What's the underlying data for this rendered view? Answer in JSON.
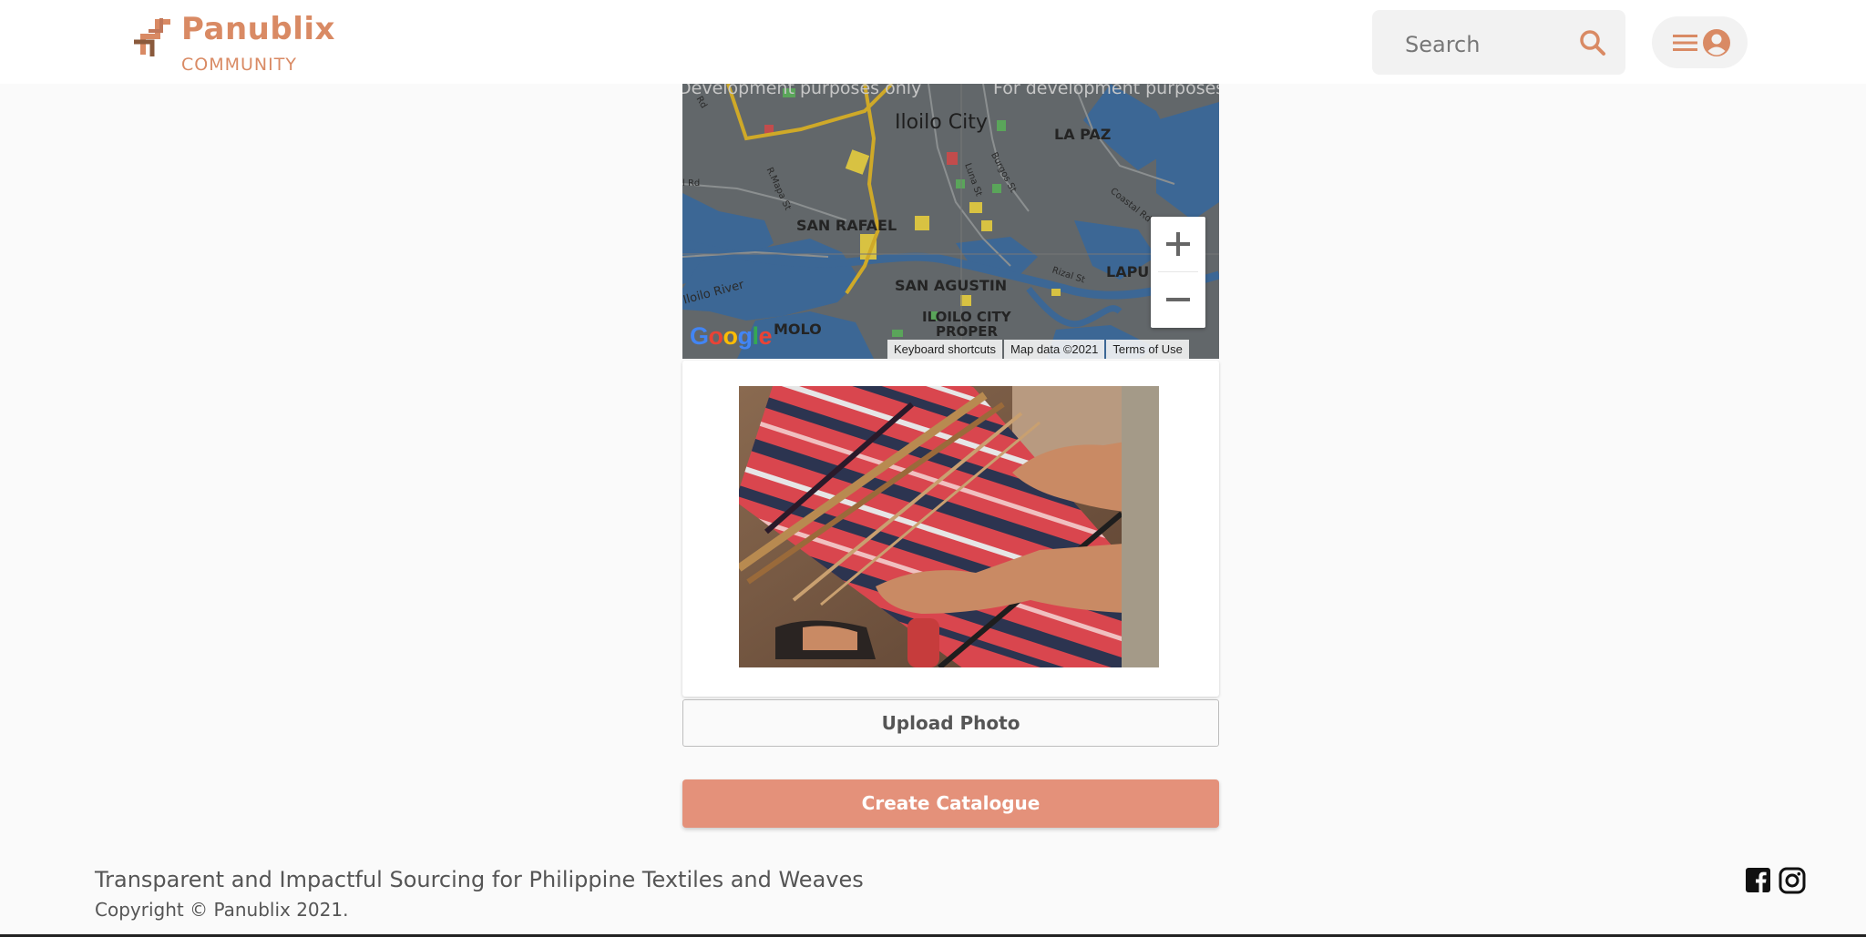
{
  "header": {
    "brand_name": "Panublix",
    "brand_sub": "COMMUNITY",
    "search_placeholder": "Search",
    "accent_color": "#d98a64"
  },
  "map": {
    "watermark_left": "Development purposes only",
    "watermark_right": "For development purposes only",
    "labels": {
      "city": "Iloilo City",
      "la_paz": "LA PAZ",
      "san_rafael": "SAN RAFAEL",
      "san_agustin": "SAN AGUSTIN",
      "lapuz": "LAPU",
      "iloilo_proper_1": "ILOILO CITY",
      "iloilo_proper_2": "PROPER",
      "molo": "MOLO",
      "river": "Iloilo River",
      "street_rd": "Rd",
      "street_rmapa": "R.Mapa St",
      "street_luna": "Luna St",
      "street_burgos": "Burgos St",
      "street_rizal": "Rizal St",
      "street_coastal": "Coastal Rd",
      "street_ird": "l Rd"
    },
    "zoom_in_label": "+",
    "zoom_out_label": "−",
    "google_logo": "Google",
    "keyboard_shortcuts": "Keyboard shortcuts",
    "map_data": "Map data ©2021",
    "terms": "Terms of Use"
  },
  "photo": {
    "alt": "weaving-loom-photo"
  },
  "actions": {
    "upload_label": "Upload Photo",
    "create_label": "Create Catalogue",
    "create_color": "#e4917a"
  },
  "footer": {
    "tagline": "Transparent and Impactful Sourcing for Philippine Textiles and Weaves",
    "copyright": "Copyright © Panublix 2021.",
    "social_icons": [
      "facebook-icon",
      "instagram-icon"
    ]
  }
}
